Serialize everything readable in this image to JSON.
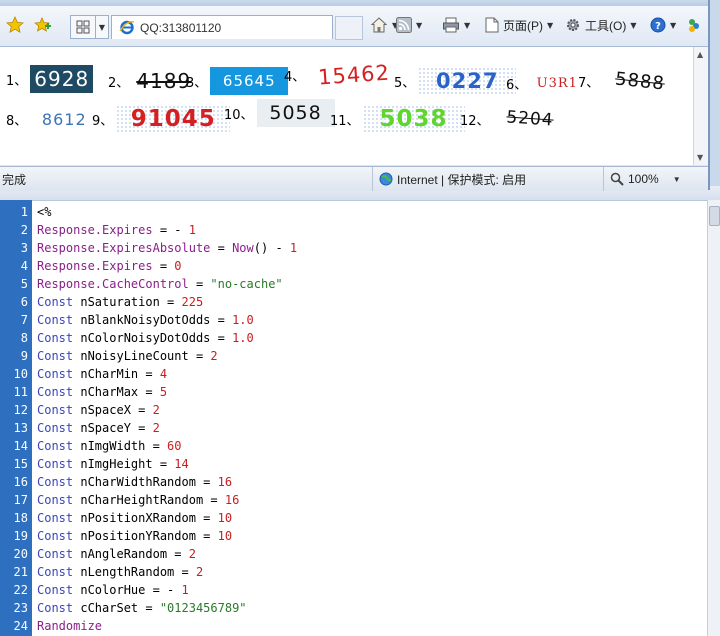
{
  "browser": {
    "tab_title": "QQ:313801120",
    "toolbar": {
      "page_label": "页面(P)",
      "tools_label": "工具(O)"
    },
    "status": {
      "left_text": "完成",
      "zone_text": "Internet | 保护模式: 启用",
      "zoom_text": "100%"
    }
  },
  "captchas": [
    {
      "label": "1、",
      "code": "6928",
      "bg": "#1e4a63",
      "fg": "#ffffff"
    },
    {
      "label": "2、",
      "code": "4189",
      "bg": "transparent",
      "fg": "#111111"
    },
    {
      "label": "3、",
      "code": "65645",
      "bg": "#1597e0",
      "fg": "#ffffff"
    },
    {
      "label": "4、",
      "code": "15462",
      "bg": "transparent",
      "fg": "#d42020"
    },
    {
      "label": "5、",
      "code": "0227",
      "bg": "transparent",
      "fg": "#2a62c8"
    },
    {
      "label": "6、",
      "code": "U3R1",
      "bg": "transparent",
      "fg": "#c81e1e"
    },
    {
      "label": "7、",
      "code": "5888",
      "bg": "transparent",
      "fg": "#111111"
    },
    {
      "label": "8、",
      "code": "8612",
      "bg": "transparent",
      "fg": "#3c74b6"
    },
    {
      "label": "9、",
      "code": "91045",
      "bg": "transparent",
      "fg": "#d42020"
    },
    {
      "label": "10、",
      "code": "5058",
      "bg": "#e9eef2",
      "fg": "#111111"
    },
    {
      "label": "11、",
      "code": "5038",
      "bg": "transparent",
      "fg": "#5ed62c"
    },
    {
      "label": "12、",
      "code": "5204",
      "bg": "transparent",
      "fg": "#111111"
    }
  ],
  "code_lines": [
    {
      "n": "1",
      "parts": [
        [
          "p",
          "<%"
        ]
      ]
    },
    {
      "n": "2",
      "parts": [
        [
          "o",
          "Response.Expires"
        ],
        [
          "p",
          " = - "
        ],
        [
          "u",
          "1"
        ]
      ]
    },
    {
      "n": "3",
      "parts": [
        [
          "o",
          "Response.ExpiresAbsolute"
        ],
        [
          "p",
          " = "
        ],
        [
          "o",
          "Now"
        ],
        [
          "p",
          "() - "
        ],
        [
          "u",
          "1"
        ]
      ]
    },
    {
      "n": "4",
      "parts": [
        [
          "o",
          "Response.Expires"
        ],
        [
          "p",
          " = "
        ],
        [
          "u",
          "0"
        ]
      ]
    },
    {
      "n": "5",
      "parts": [
        [
          "o",
          "Response.CacheControl"
        ],
        [
          "p",
          " = "
        ],
        [
          "s",
          "\"no-cache\""
        ]
      ]
    },
    {
      "n": "6",
      "parts": [
        [
          "k",
          "Const"
        ],
        [
          "p",
          " nSaturation = "
        ],
        [
          "u",
          "225"
        ]
      ]
    },
    {
      "n": "7",
      "parts": [
        [
          "k",
          "Const"
        ],
        [
          "p",
          " nBlankNoisyDotOdds = "
        ],
        [
          "u",
          "1.0"
        ]
      ]
    },
    {
      "n": "8",
      "parts": [
        [
          "k",
          "Const"
        ],
        [
          "p",
          " nColorNoisyDotOdds = "
        ],
        [
          "u",
          "1.0"
        ]
      ]
    },
    {
      "n": "9",
      "parts": [
        [
          "k",
          "Const"
        ],
        [
          "p",
          " nNoisyLineCount = "
        ],
        [
          "u",
          "2"
        ]
      ]
    },
    {
      "n": "10",
      "parts": [
        [
          "k",
          "Const"
        ],
        [
          "p",
          " nCharMin = "
        ],
        [
          "u",
          "4"
        ]
      ]
    },
    {
      "n": "11",
      "parts": [
        [
          "k",
          "Const"
        ],
        [
          "p",
          " nCharMax = "
        ],
        [
          "u",
          "5"
        ]
      ]
    },
    {
      "n": "12",
      "parts": [
        [
          "k",
          "Const"
        ],
        [
          "p",
          " nSpaceX = "
        ],
        [
          "u",
          "2"
        ]
      ]
    },
    {
      "n": "13",
      "parts": [
        [
          "k",
          "Const"
        ],
        [
          "p",
          " nSpaceY = "
        ],
        [
          "u",
          "2"
        ]
      ]
    },
    {
      "n": "14",
      "parts": [
        [
          "k",
          "Const"
        ],
        [
          "p",
          " nImgWidth = "
        ],
        [
          "u",
          "60"
        ]
      ]
    },
    {
      "n": "15",
      "parts": [
        [
          "k",
          "Const"
        ],
        [
          "p",
          " nImgHeight = "
        ],
        [
          "u",
          "14"
        ]
      ]
    },
    {
      "n": "16",
      "parts": [
        [
          "k",
          "Const"
        ],
        [
          "p",
          " nCharWidthRandom = "
        ],
        [
          "u",
          "16"
        ]
      ]
    },
    {
      "n": "17",
      "parts": [
        [
          "k",
          "Const"
        ],
        [
          "p",
          " nCharHeightRandom = "
        ],
        [
          "u",
          "16"
        ]
      ]
    },
    {
      "n": "18",
      "parts": [
        [
          "k",
          "Const"
        ],
        [
          "p",
          " nPositionXRandom = "
        ],
        [
          "u",
          "10"
        ]
      ]
    },
    {
      "n": "19",
      "parts": [
        [
          "k",
          "Const"
        ],
        [
          "p",
          " nPositionYRandom = "
        ],
        [
          "u",
          "10"
        ]
      ]
    },
    {
      "n": "20",
      "parts": [
        [
          "k",
          "Const"
        ],
        [
          "p",
          " nAngleRandom = "
        ],
        [
          "u",
          "2"
        ]
      ]
    },
    {
      "n": "21",
      "parts": [
        [
          "k",
          "Const"
        ],
        [
          "p",
          " nLengthRandom = "
        ],
        [
          "u",
          "2"
        ]
      ]
    },
    {
      "n": "22",
      "parts": [
        [
          "k",
          "Const"
        ],
        [
          "p",
          " nColorHue = - "
        ],
        [
          "u",
          "1"
        ]
      ]
    },
    {
      "n": "23",
      "parts": [
        [
          "k",
          "Const"
        ],
        [
          "p",
          " cCharSet = "
        ],
        [
          "s",
          "\"0123456789\""
        ]
      ]
    },
    {
      "n": "24",
      "parts": [
        [
          "o",
          "Randomize"
        ]
      ]
    }
  ]
}
